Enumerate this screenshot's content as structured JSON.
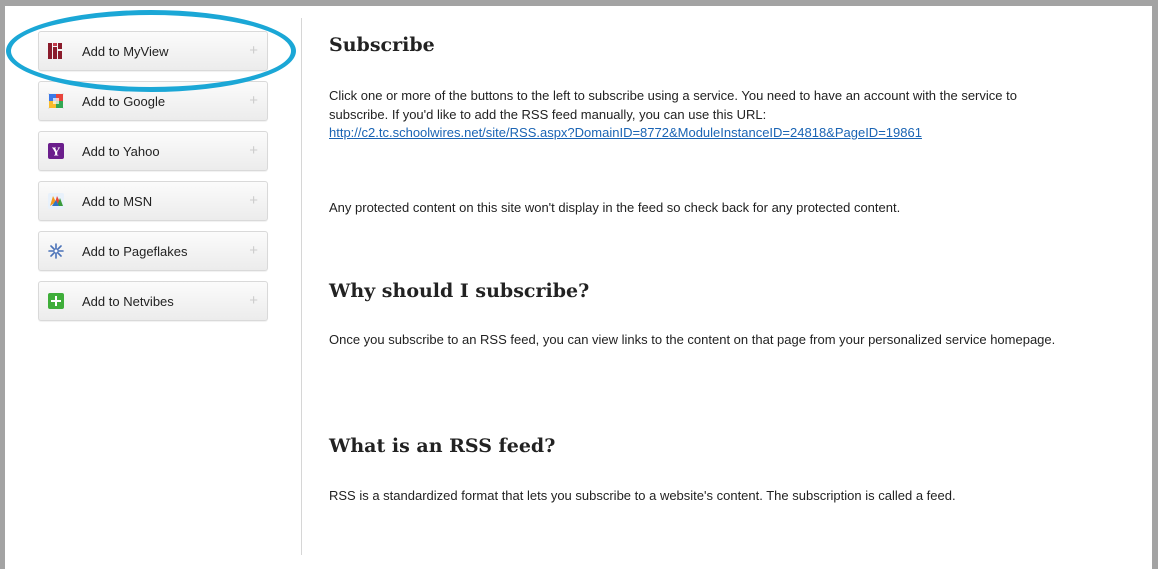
{
  "sidebar": {
    "services": [
      {
        "label": "Add to MyView",
        "icon": "myview-icon"
      },
      {
        "label": "Add to Google",
        "icon": "google-icon"
      },
      {
        "label": "Add to Yahoo",
        "icon": "yahoo-icon"
      },
      {
        "label": "Add to MSN",
        "icon": "msn-icon"
      },
      {
        "label": "Add to Pageflakes",
        "icon": "pageflakes-icon"
      },
      {
        "label": "Add to Netvibes",
        "icon": "netvibes-icon"
      }
    ],
    "plus_symbol": "+"
  },
  "content": {
    "subscribe": {
      "title": "Subscribe",
      "intro": "Click one or more of the buttons to the left to subscribe using a service. You need to have an account with the service to subscribe. If you'd like to add the RSS feed manually, you can use this URL:",
      "feed_url": "http://c2.tc.schoolwires.net/site/RSS.aspx?DomainID=8772&ModuleInstanceID=24818&PageID=19861",
      "protected_note": "Any protected content on this site won't display in the feed so check back for any protected content."
    },
    "why": {
      "title": "Why should I subscribe?",
      "body": "Once you subscribe to an RSS feed, you can view links to the content on that page from your personalized service homepage."
    },
    "what": {
      "title": "What is an RSS feed?",
      "body": "RSS is a standardized format that lets you subscribe to a website's content. The subscription is called a feed."
    }
  },
  "colors": {
    "highlight_ring": "#1ba7d6",
    "link": "#1a64b4",
    "frame": "#a3a3a3"
  }
}
